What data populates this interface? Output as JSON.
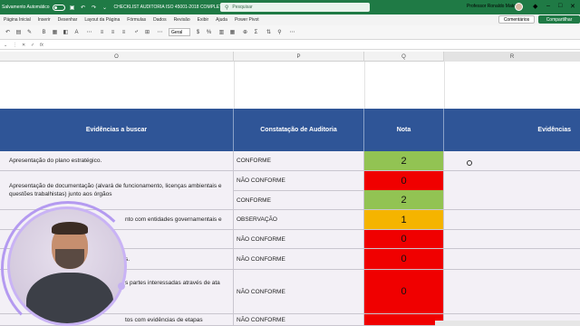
{
  "titlebar": {
    "autosave": "Salvamento Automático",
    "filename": "CHECKLIST AUDITORIA ISO 45001-2018 COMPLETO",
    "search_placeholder": "Pesquisar",
    "user": "Professor Ronaldo Matos"
  },
  "ribbon": {
    "tabs": [
      "Página Inicial",
      "Inserir",
      "Desenhar",
      "Layout da Página",
      "Fórmulas",
      "Dados",
      "Revisão",
      "Exibir",
      "Ajuda",
      "Power Pivot"
    ],
    "comments_label": "Comentários",
    "share_label": "Compartilhar"
  },
  "toolbar": {
    "font_name": "Geral"
  },
  "formula_bar": {
    "cell_ref": "",
    "fx": "fx"
  },
  "columns": [
    "O",
    "P",
    "Q",
    "R"
  ],
  "table": {
    "headers": {
      "evidencias": "Evidências a buscar",
      "constatacao": "Constatação de Auditoria",
      "nota": "Nota",
      "evidencias2": "Evidências"
    },
    "rows": [
      {
        "ev": "Apresentação do plano estratégico.",
        "con": "CONFORME",
        "nota": "2",
        "color": "#92c353"
      },
      {
        "ev": "Apresentação de documentação (alvará de funcionamento, licenças ambientais e questões trabalhistas) junto aos órgãos",
        "con": "NÃO CONFORME",
        "nota": "0",
        "color": "#f00000"
      },
      {
        "ev": "",
        "con": "CONFORME",
        "nota": "2",
        "color": "#92c353"
      },
      {
        "ev": "nto com entidades governamentais e",
        "con": "OBSERVAÇÃO",
        "nota": "1",
        "color": "#f5b400"
      },
      {
        "ev": "",
        "con": "NÃO CONFORME",
        "nota": "0",
        "color": "#f00000"
      },
      {
        "ev": "s.",
        "con": "NÃO CONFORME",
        "nota": "0",
        "color": "#f00000"
      },
      {
        "ev": "s partes interessadas através de ata",
        "con": "NÃO CONFORME",
        "nota": "0",
        "color": "#f00000"
      },
      {
        "ev": "tos com evidências de etapas",
        "con": "NÃO CONFORME",
        "nota": "",
        "color": "#f00000"
      }
    ]
  }
}
